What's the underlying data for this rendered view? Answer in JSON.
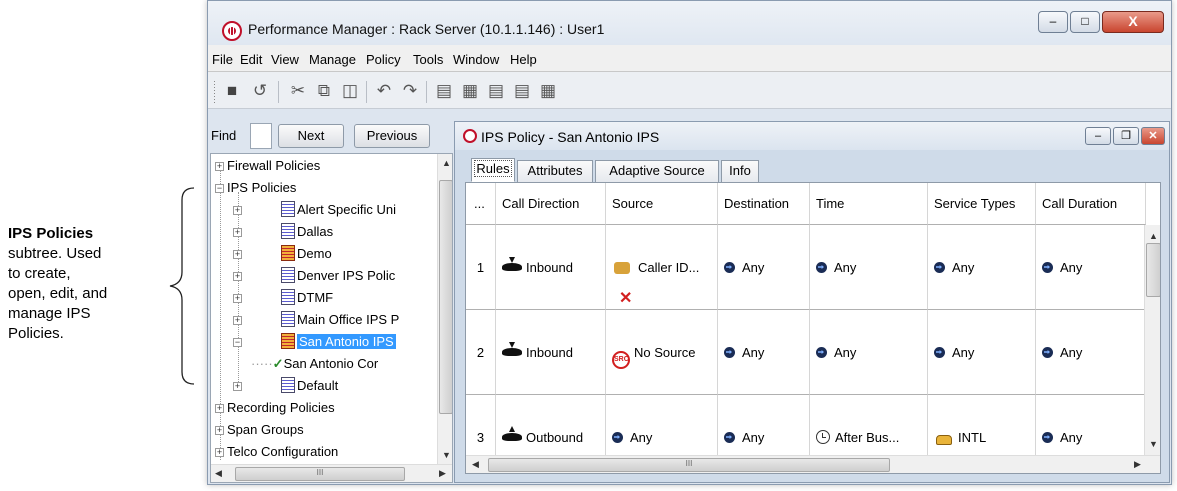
{
  "callout": {
    "title": "IPS Policies",
    "lines": [
      "subtree. Used",
      "to  create,",
      "open, edit, and",
      "manage IPS",
      "Policies."
    ]
  },
  "window": {
    "title": "Performance Manager : Rack Server (10.1.1.146) : User1",
    "close_glyph": "X",
    "max_glyph": "□",
    "min_glyph": "–"
  },
  "menu": [
    "File",
    "Edit",
    "View",
    "Manage",
    "Policy",
    "Tools",
    "Window",
    "Help"
  ],
  "toolbar_icons": [
    "save-icon",
    "undo-icon",
    "cut-icon",
    "copy-icon",
    "paste-icon",
    "back-icon",
    "forward-icon",
    "add-row-icon",
    "insert-row-icon",
    "move-up-icon",
    "move-down-icon",
    "delete-row-icon"
  ],
  "find": {
    "label": "Find",
    "next_label": "Next",
    "previous_label": "Previous",
    "value": ""
  },
  "tree": {
    "firewall": "Firewall Policies",
    "ips": "IPS Policies",
    "children": [
      "Alert Specific Uni",
      "Dallas",
      "Demo",
      "Denver IPS Polic",
      "DTMF",
      "Main Office IPS P",
      "San Antonio IPS"
    ],
    "sub_child": "San Antonio Cor",
    "default": "Default",
    "recording": "Recording Policies",
    "span": "Span Groups",
    "telco": "Telco Configuration",
    "selected": "San Antonio IPS",
    "scroll_thumb_glyph": "III"
  },
  "inner": {
    "title": "IPS Policy - San Antonio IPS",
    "tabs": [
      "Rules",
      "Attributes",
      "Adaptive Source",
      "Info"
    ],
    "active_tab": "Rules"
  },
  "grid": {
    "columns": [
      "...",
      "Call Direction",
      "Source",
      "Destination",
      "Time",
      "Service Types",
      "Call Duration"
    ],
    "rows": [
      {
        "num": "1",
        "direction": "Inbound",
        "source": "Caller ID...",
        "destination": "Any",
        "time": "Any",
        "service": "Any",
        "duration": "Any"
      },
      {
        "num": "2",
        "direction": "Inbound",
        "source": "No Source",
        "destination": "Any",
        "time": "Any",
        "service": "Any",
        "duration": "Any"
      },
      {
        "num": "3",
        "direction": "Outbound",
        "source": "Any",
        "destination": "Any",
        "time": "After Bus...",
        "service": "INTL",
        "duration": "Any"
      }
    ],
    "hscroll_glyph": "III"
  },
  "colors": {
    "selection": "#3399ff",
    "close_button": "#c9452f",
    "accent_red": "#c0102a"
  }
}
